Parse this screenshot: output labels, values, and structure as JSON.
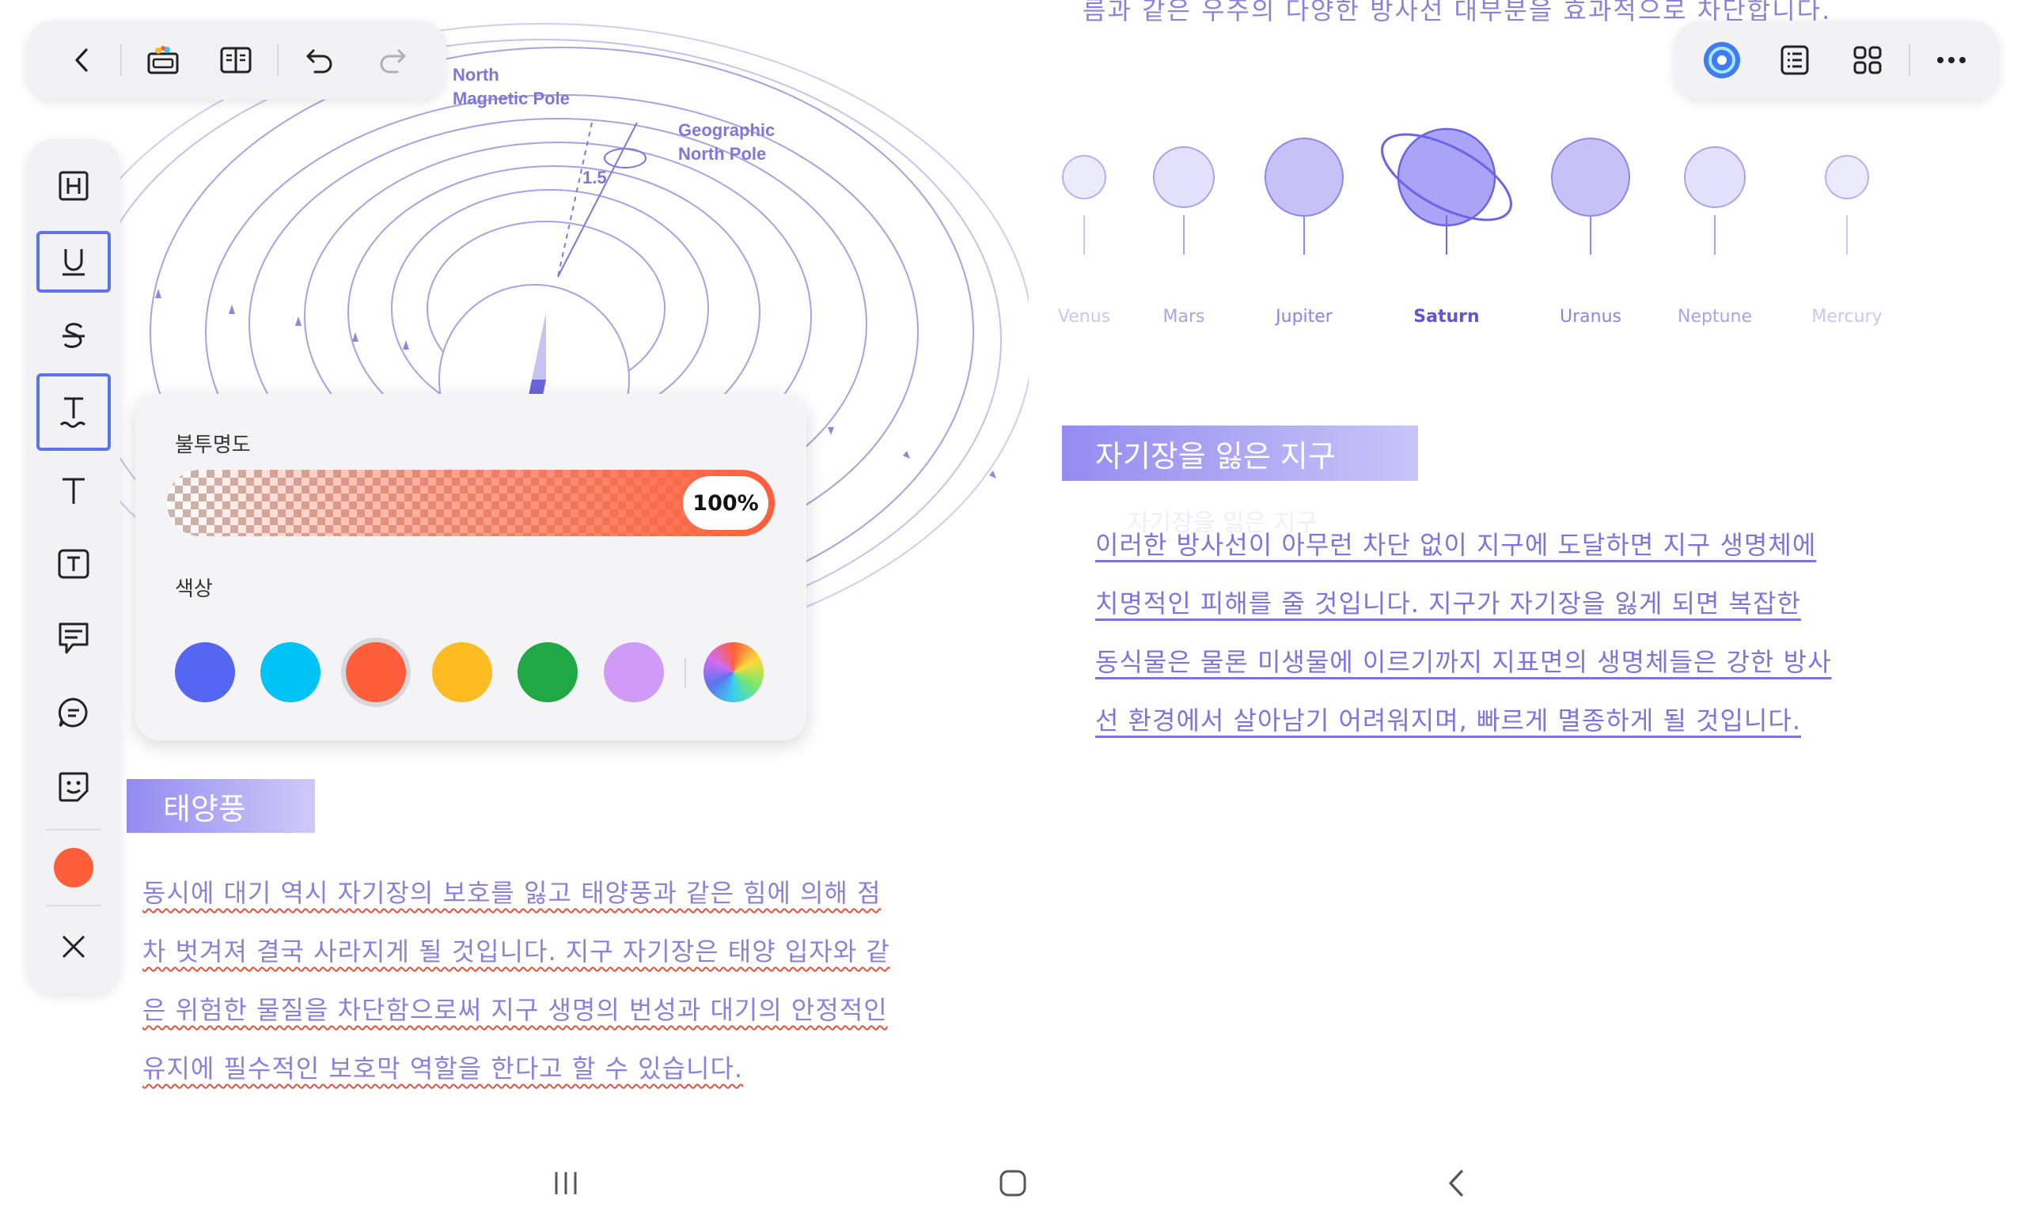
{
  "top_toolbar": {
    "back": "back-icon",
    "items": [
      "sticker-gallery-icon",
      "reading-mode-icon",
      "undo-icon",
      "redo-icon"
    ]
  },
  "right_toolbar": {
    "items": [
      "ai-assistant-icon",
      "outline-icon",
      "grid-view-icon",
      "more-icon"
    ]
  },
  "left_toolbar": {
    "tools": [
      "heading-tool",
      "underline-tool",
      "strikethrough-tool",
      "text-effect-tool",
      "text-tool",
      "text-box-tool",
      "comment-tool",
      "chat-comment-tool",
      "sticker-tool"
    ],
    "current_color": "#ff5e3a"
  },
  "popup": {
    "opacity_label": "불투명도",
    "opacity_value": "100%",
    "opacity_fraction": 1.0,
    "color_label": "색상",
    "colors": [
      "#5566f2",
      "#00c3f5",
      "#ff5e3a",
      "#ffbb22",
      "#1fa845",
      "#cf9bf6"
    ],
    "selected_color": "#ff5e3a"
  },
  "diagram": {
    "north_magnetic_pole": [
      "North",
      "Magnetic Pole"
    ],
    "geographic_north_pole": [
      "Geographic",
      "North Pole"
    ],
    "angle": "1.5"
  },
  "top_cut_text": "름과 같은 우주의 다양한 방사선 대부분을 효과적으로 차단합니다.",
  "planets": [
    {
      "name": "Venus"
    },
    {
      "name": "Mars"
    },
    {
      "name": "Jupiter"
    },
    {
      "name": "Saturn"
    },
    {
      "name": "Uranus"
    },
    {
      "name": "Neptune"
    },
    {
      "name": "Mercury"
    }
  ],
  "section1": {
    "heading": "자기장을 잃은 지구",
    "ghost": "자기장을 잃은 지구",
    "lines": [
      "이러한 방사선이 아무런 차단 없이 지구에 도달하면 지구 생명체에",
      "치명적인 피해를 줄 것입니다. 지구가 자기장을 잃게 되면 복잡한",
      "동식물은 물론 미생물에 이르기까지 지표면의 생명체들은 강한 방사",
      "선 환경에서 살아남기 어려워지며, 빠르게 멸종하게 될 것입니다."
    ]
  },
  "section2": {
    "heading": "태양풍",
    "lines": [
      "동시에 대기 역시 자기장의 보호를 잃고 태양풍과 같은 힘에 의해 점",
      "차 벗겨져 결국 사라지게 될 것입니다. 지구 자기장은 태양 입자와 같",
      "은 위험한 물질을 차단함으로써 지구 생명의 번성과 대기의 안정적인",
      "유지에 필수적인 보호막 역할을 한다고 할 수 있습니다."
    ]
  },
  "nav": [
    "recents-icon",
    "home-icon",
    "back-nav-icon"
  ]
}
